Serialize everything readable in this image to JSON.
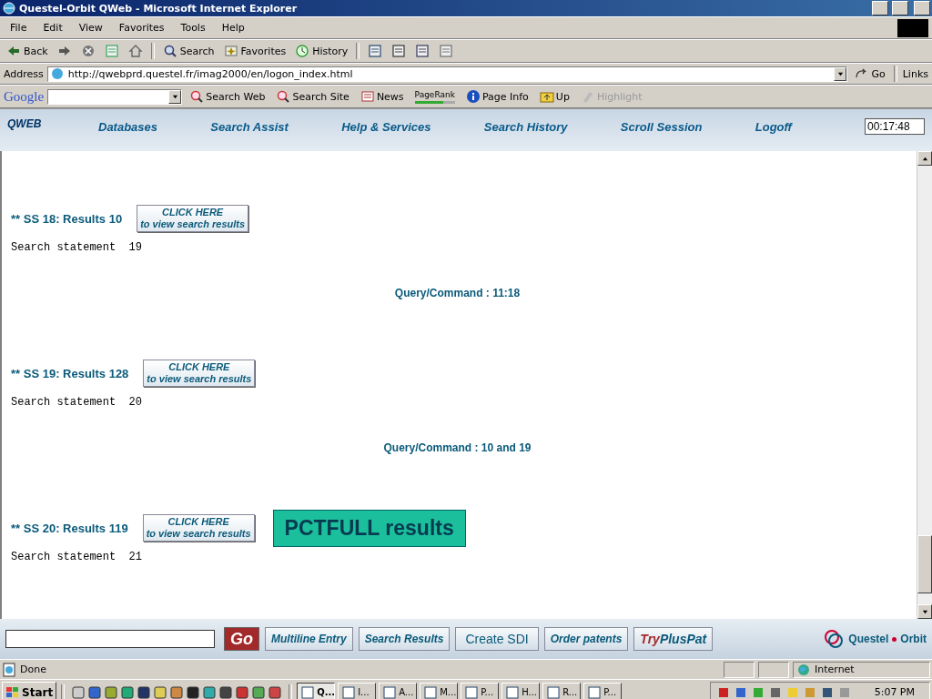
{
  "window": {
    "title": "Questel-Orbit QWeb - Microsoft Internet Explorer"
  },
  "menu": [
    "File",
    "Edit",
    "View",
    "Favorites",
    "Tools",
    "Help"
  ],
  "toolbar": [
    {
      "kind": "back",
      "label": "Back"
    },
    {
      "kind": "forward"
    },
    {
      "kind": "stop"
    },
    {
      "kind": "refresh"
    },
    {
      "kind": "home"
    },
    {
      "kind": "search",
      "label": "Search"
    },
    {
      "kind": "favorites",
      "label": "Favorites"
    },
    {
      "kind": "history",
      "label": "History"
    },
    {
      "kind": "mail"
    },
    {
      "kind": "print"
    },
    {
      "kind": "edit"
    },
    {
      "kind": "discuss"
    }
  ],
  "address": {
    "label": "Address",
    "value": "http://qwebprd.questel.fr/imag2000/en/logon_index.html",
    "go": "Go",
    "links": "Links"
  },
  "google_bar": {
    "logo": "Google",
    "items": [
      {
        "kind": "search-web",
        "label": "Search Web",
        "disabled": false
      },
      {
        "kind": "search-site",
        "label": "Search Site",
        "disabled": false
      },
      {
        "kind": "news",
        "label": "News",
        "disabled": false
      },
      {
        "kind": "pagerank",
        "label": "PageRank",
        "disabled": false
      },
      {
        "kind": "page-info",
        "label": "Page Info",
        "disabled": false
      },
      {
        "kind": "up",
        "label": "Up",
        "disabled": false
      },
      {
        "kind": "highlight",
        "label": "Highlight",
        "disabled": true
      }
    ]
  },
  "qweb_nav": {
    "logo": "QWEB",
    "items": [
      "Databases",
      "Search Assist",
      "Help & Services",
      "Search History",
      "Scroll Session",
      "Logoff"
    ],
    "timer": "00:17:48"
  },
  "results": [
    {
      "summary": "** SS 18: Results 10",
      "button": [
        "CLICK HERE",
        "to view search results"
      ],
      "statement": "Search statement  19",
      "query": "Query/Command : 11:18"
    },
    {
      "summary": "** SS 19: Results 128",
      "button": [
        "CLICK HERE",
        "to view search results"
      ],
      "statement": "Search statement  20",
      "query": "Query/Command : 10 and 19"
    },
    {
      "summary": "** SS 20: Results 119",
      "button": [
        "CLICK HERE",
        "to view search results"
      ],
      "badge": "PCTFULL results",
      "statement": "Search statement  21"
    }
  ],
  "bottom_bar": {
    "go": "Go",
    "buttons": [
      {
        "kind": "plain",
        "label": "Multiline Entry"
      },
      {
        "kind": "plain",
        "label": "Search Results"
      },
      {
        "kind": "upright",
        "label": "Create SDI"
      },
      {
        "kind": "plain",
        "label": "Order patents"
      },
      {
        "kind": "promo",
        "label": "Try ",
        "strong": "PlusPat"
      }
    ],
    "brand": [
      "Questel",
      "Orbit"
    ]
  },
  "status_bar": {
    "text": "Done",
    "zone": "Internet"
  },
  "taskbar": {
    "start": "Start",
    "tasks": [
      {
        "label": "Q...",
        "selected": true
      },
      {
        "label": "I...",
        "selected": false
      },
      {
        "label": "A...",
        "selected": false
      },
      {
        "label": "M...",
        "selected": false
      },
      {
        "label": "P...",
        "selected": false
      },
      {
        "label": "H...",
        "selected": false
      },
      {
        "label": "R...",
        "selected": false
      },
      {
        "label": "P...",
        "selected": false
      }
    ],
    "clock": "5:07 PM"
  }
}
